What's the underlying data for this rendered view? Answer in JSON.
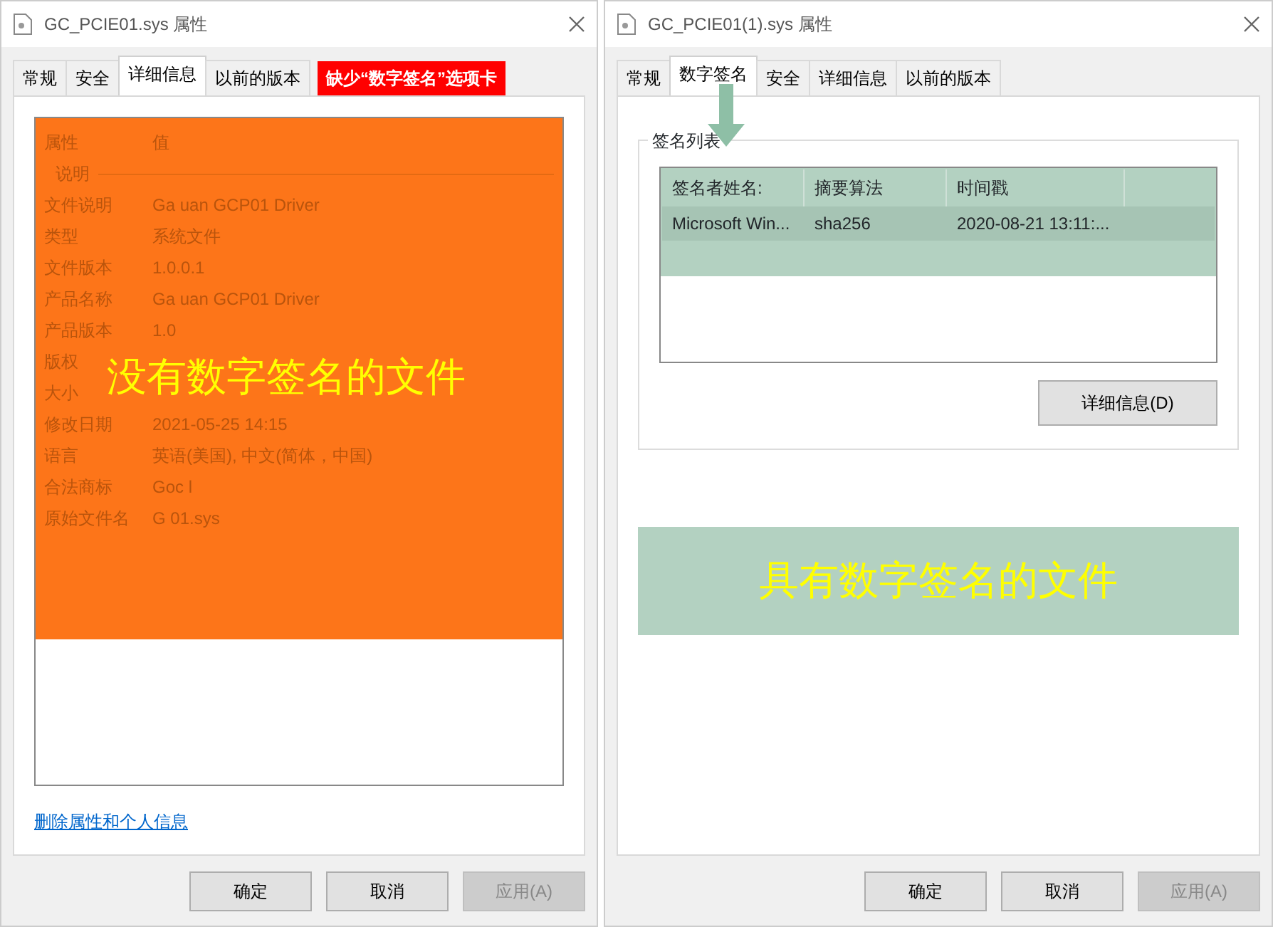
{
  "dialogs": [
    {
      "kind": "details",
      "title": "GC_PCIE01.sys 属性",
      "tabs": [
        {
          "label": "常规",
          "selected": false
        },
        {
          "label": "安全",
          "selected": false
        },
        {
          "label": "详细信息",
          "selected": true
        },
        {
          "label": "以前的版本",
          "selected": false
        }
      ],
      "annotation_badge": "缺少“数字签名”选项卡",
      "columns": [
        "属性",
        "值"
      ],
      "group": "说明",
      "rows": [
        {
          "key": "文件说明",
          "value": "Ga   uan GCP01 Driver"
        },
        {
          "key": "类型",
          "value": "系统文件"
        },
        {
          "key": "文件版本",
          "value": "1.0.0.1"
        },
        {
          "key": "产品名称",
          "value": "Ga   uan GCP01 Driver"
        },
        {
          "key": "产品版本",
          "value": "1.0"
        }
      ],
      "covered_keys": [
        "版权",
        "大小"
      ],
      "caption": "没有数字签名的文件",
      "rows_after": [
        {
          "key": "修改日期",
          "value": "2021-05-25 14:15"
        },
        {
          "key": "语言",
          "value": "英语(美国), 中文(简体，中国)"
        },
        {
          "key": "合法商标",
          "value": "Goc  l"
        },
        {
          "key": "原始文件名",
          "value": "G    01.sys"
        }
      ],
      "link": "删除属性和个人信息",
      "buttons": [
        {
          "label": "确定",
          "disabled": false
        },
        {
          "label": "取消",
          "disabled": false
        },
        {
          "label": "应用(A)",
          "disabled": true
        }
      ]
    },
    {
      "kind": "signatures",
      "title": "GC_PCIE01(1).sys 属性",
      "tabs": [
        {
          "label": "常规",
          "selected": false
        },
        {
          "label": "数字签名",
          "selected": true
        },
        {
          "label": "安全",
          "selected": false
        },
        {
          "label": "详细信息",
          "selected": false
        },
        {
          "label": "以前的版本",
          "selected": false
        }
      ],
      "group": "签名列表",
      "columns": [
        "签名者姓名:",
        "摘要算法",
        "时间戳"
      ],
      "rows": [
        [
          "Microsoft Win...",
          "sha256",
          "2020-08-21 13:11:..."
        ]
      ],
      "details_button": "详细信息(D)",
      "caption": "具有数字签名的文件",
      "buttons": [
        {
          "label": "确定",
          "disabled": false
        },
        {
          "label": "取消",
          "disabled": false
        },
        {
          "label": "应用(A)",
          "disabled": true
        }
      ]
    }
  ]
}
